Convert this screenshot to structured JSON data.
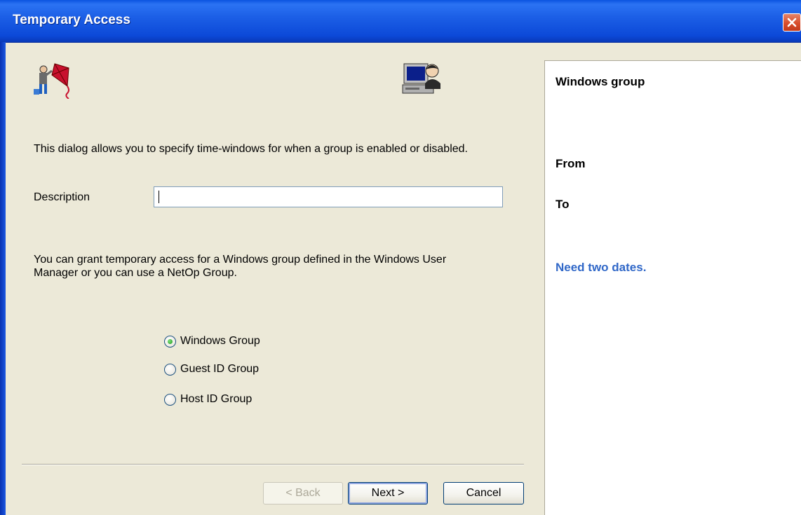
{
  "window": {
    "title": "Temporary Access"
  },
  "intro_text": "This dialog allows you to specify time-windows for when a group is enabled or disabled.",
  "description": {
    "label": "Description",
    "value": "",
    "placeholder": ""
  },
  "grant_text_line1": "You can grant temporary access for a Windows group defined in the Windows User",
  "grant_text_line2": "Manager or you can use a NetOp Group.",
  "group_options": [
    {
      "label": "Windows Group",
      "selected": true
    },
    {
      "label": "Guest ID Group",
      "selected": false
    },
    {
      "label": "Host ID Group",
      "selected": false
    }
  ],
  "buttons": {
    "back": "< Back",
    "next": "Next >",
    "cancel": "Cancel"
  },
  "summary": {
    "group": "Windows group",
    "from": "From",
    "to": "To",
    "note": "Need two dates."
  },
  "colors": {
    "title_bar": "#0c49d8",
    "note": "#3168c8",
    "dialog_bg": "#ece9d8"
  },
  "icons": [
    "technician-with-kite-icon",
    "computer-user-icon",
    "close-icon"
  ]
}
